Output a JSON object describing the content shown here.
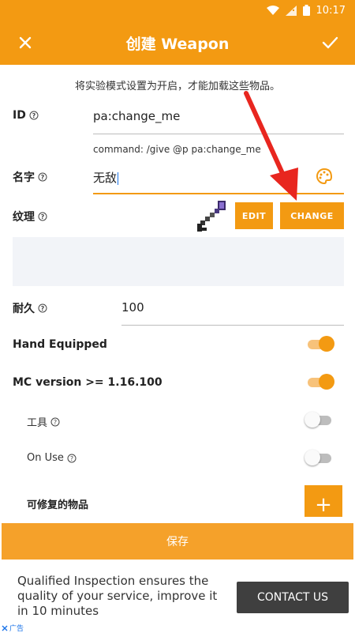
{
  "status_bar": {
    "time": "10:17"
  },
  "app_bar": {
    "title": "创建 Weapon"
  },
  "notice": "将实验模式设置为开启，才能加载这些物品。",
  "id_field": {
    "label": "ID",
    "value": "pa:change_me",
    "command_hint": "command: /give @p pa:change_me"
  },
  "name_field": {
    "label": "名字",
    "value": "无敌"
  },
  "texture": {
    "label": "纹理",
    "edit_label": "EDIT",
    "change_label": "CHANGE"
  },
  "durability": {
    "label": "耐久",
    "value": "100"
  },
  "toggles": {
    "hand_equipped": {
      "label": "Hand Equipped",
      "on": true
    },
    "mc_version": {
      "label": "MC version >= 1.16.100",
      "on": true
    },
    "tool": {
      "label": "工具",
      "on": false
    },
    "on_use": {
      "label": "On Use",
      "on": false
    }
  },
  "repairable": {
    "label": "可修复的物品",
    "add_label": "+"
  },
  "save_label": "保存",
  "ad": {
    "text": "Qualified Inspection ensures the quality of your service, improve it in 10 minutes",
    "button": "CONTACT US",
    "badge": "广告"
  },
  "colors": {
    "accent": "#f39a12",
    "annotation_arrow": "#e8261f"
  }
}
